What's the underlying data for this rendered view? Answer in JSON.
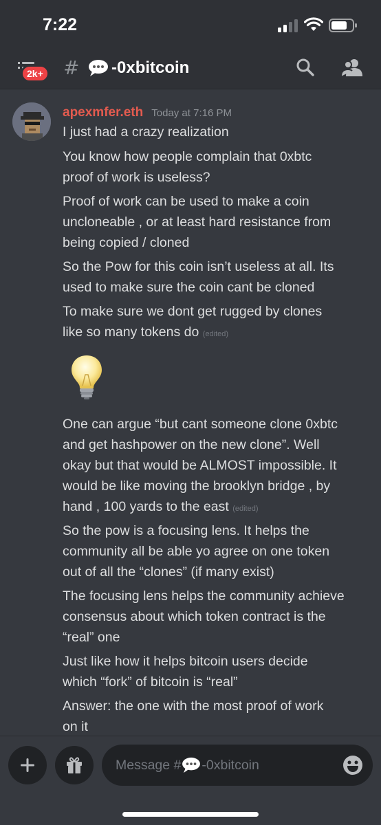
{
  "status_bar": {
    "time": "7:22"
  },
  "header": {
    "unread_badge": "2k+",
    "hash_symbol": "#",
    "channel_name": "-0xbitcoin",
    "icons": [
      "menu-icon",
      "hash-icon",
      "speech-bubble-icon",
      "search-icon",
      "members-icon"
    ]
  },
  "message": {
    "author": "apexmfer.eth",
    "timestamp": "Today at 7:16 PM",
    "author_color": "#e45b4f",
    "lines": [
      "I just had a crazy realization",
      "You know how people complain that 0xbtc",
      "proof of work is useless?",
      "Proof of work can be used to make a coin",
      "uncloneable , or at least hard resistance from",
      "being copied / cloned",
      "So the Pow for this coin isn’t useless at all. Its",
      "used to make sure the coin cant be cloned",
      "To make sure we dont get rugged by clones",
      "like so many tokens do",
      "One can argue “but cant someone clone 0xbtc",
      "and get hashpower on the new clone”. Well",
      "okay but that would be ALMOST impossible.  It",
      "would be like moving the brooklyn bridge , by",
      "hand , 100 yards to the east",
      "So the pow is a focusing lens.  It helps the",
      "community all be able yo agree on one token",
      "out of all the “clones” (if many exist)",
      "The focusing lens helps the community achieve",
      "consensus about which token contract is the",
      "“real” one",
      "Just like how it helps bitcoin users decide",
      "which “fork” of bitcoin is “real”",
      "Answer: the one with the most proof of work",
      "on it"
    ],
    "edited_label": "(edited)",
    "emoji": "light-bulb-icon"
  },
  "composer": {
    "placeholder_prefix": "Message #",
    "placeholder_channel": "-0xbitcoin"
  },
  "colors": {
    "background": "#36393f",
    "header_background": "#2f3136",
    "badge": "#ed4245",
    "input_background": "#202225"
  }
}
